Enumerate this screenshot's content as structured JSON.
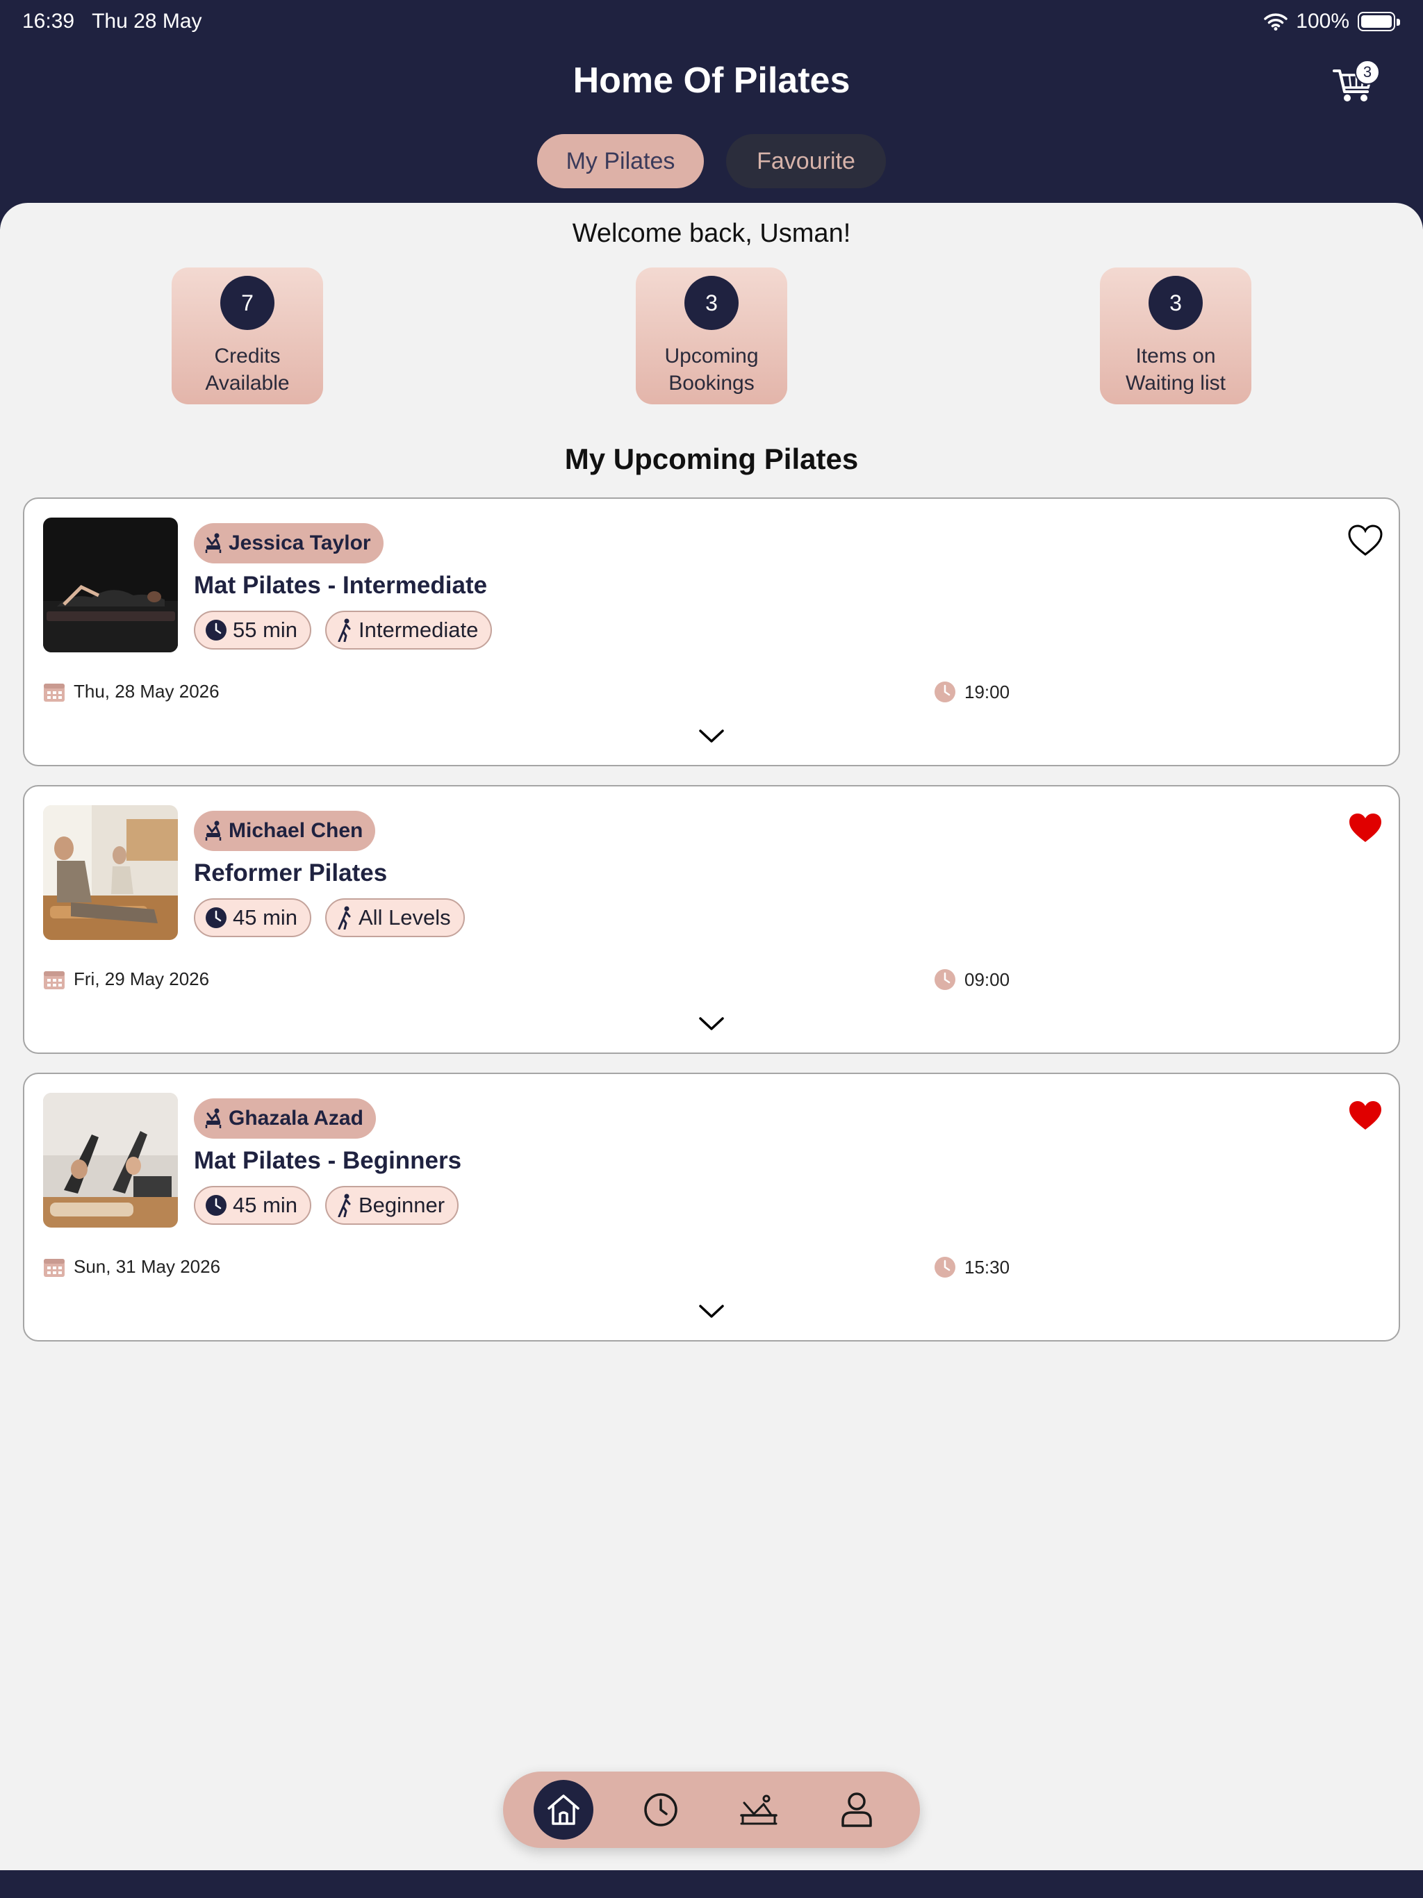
{
  "status_bar": {
    "time": "16:39",
    "date": "Thu 28 May",
    "battery": "100%"
  },
  "header": {
    "title": "Home Of Pilates",
    "cart_count": "3"
  },
  "tabs": [
    {
      "label": "My Pilates"
    },
    {
      "label": "Favourite"
    }
  ],
  "welcome": "Welcome back, Usman!",
  "stats": [
    {
      "value": "7",
      "line1": "Credits",
      "line2": "Available"
    },
    {
      "value": "3",
      "line1": "Upcoming",
      "line2": "Bookings"
    },
    {
      "value": "3",
      "line1": "Items on",
      "line2": "Waiting list"
    }
  ],
  "section_title": "My Upcoming Pilates",
  "classes": [
    {
      "instructor": "Jessica Taylor",
      "title": "Mat Pilates - Intermediate",
      "duration": "55 min",
      "level": "Intermediate",
      "date": "Thu, 28 May 2026",
      "time": "19:00",
      "favourite": false
    },
    {
      "instructor": "Michael Chen",
      "title": "Reformer Pilates",
      "duration": "45 min",
      "level": "All Levels",
      "date": "Fri, 29 May 2026",
      "time": "09:00",
      "favourite": true
    },
    {
      "instructor": "Ghazala Azad",
      "title": "Mat Pilates - Beginners",
      "duration": "45 min",
      "level": "Beginner",
      "date": "Sun, 31 May 2026",
      "time": "15:30",
      "favourite": true
    }
  ],
  "colors": {
    "navy": "#1f2240",
    "rose": "#ddb1a7",
    "heart": "#e00000"
  },
  "bottom_nav": [
    {
      "icon": "home-icon",
      "active": true
    },
    {
      "icon": "clock-icon",
      "active": false
    },
    {
      "icon": "reformer-icon",
      "active": false
    },
    {
      "icon": "profile-icon",
      "active": false
    }
  ]
}
